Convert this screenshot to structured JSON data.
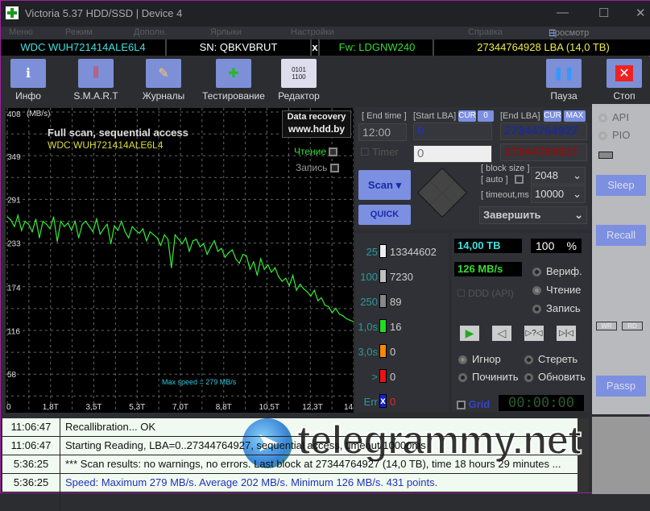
{
  "window": {
    "title": "Victoria 5.37 HDD/SSD | Device 4"
  },
  "menu": {
    "items": [
      "Меню",
      "Режим",
      "Дополн.",
      "Ярлыки",
      "Настройки",
      "Справка"
    ],
    "buffer_view": "Просмотр буфера"
  },
  "drive": {
    "model": "WDC  WUH721414ALE6L4",
    "serial": "SN: QBKVBRUT",
    "close": "x",
    "firmware": "Fw: LDGNW240",
    "capacity": "27344764928 LBA (14,0 TB)"
  },
  "toolbar": {
    "info": "Инфо",
    "smart": "S.M.A.R.T",
    "logs": "Журналы",
    "testing": "Тестирование",
    "editor": "Редактор",
    "pause": "Пауза",
    "stop": "Стоп"
  },
  "chart_overlay": {
    "title": "Full scan, sequential access",
    "model": "WDC  WUH721414ALE6L4",
    "brand_line1": "Data recovery",
    "brand_line2": "www.hdd.by",
    "legend_read": "Чтение",
    "legend_write": "Запись",
    "max_speed": "Max speed = 279 MB/s"
  },
  "chart_data": {
    "type": "line",
    "ylabel": "(MB/s)",
    "ylim": [
      0,
      408
    ],
    "xlim": [
      0,
      14
    ],
    "yticks": [
      "408",
      "349",
      "291",
      "233",
      "174",
      "116",
      "58"
    ],
    "ytick_values": [
      408,
      349,
      291,
      233,
      174,
      116,
      58
    ],
    "xticks": [
      "0",
      "1,8T",
      "3,5T",
      "5,3T",
      "7,0T",
      "8,8T",
      "10,5T",
      "12,3T",
      "14"
    ],
    "xtick_values": [
      0,
      1.75,
      3.5,
      5.25,
      7,
      8.75,
      10.5,
      12.25,
      14
    ],
    "series": [
      {
        "name": "Чтение",
        "color": "#33ee33",
        "values": [
          268,
          264,
          255,
          270,
          250,
          262,
          258,
          248,
          265,
          240,
          262,
          258,
          252,
          268,
          235,
          262,
          255,
          260,
          250,
          262,
          240,
          258,
          262,
          255,
          248,
          265,
          245,
          252,
          258,
          232,
          256,
          250,
          262,
          248,
          240,
          255,
          250,
          246,
          252,
          236,
          248,
          244,
          240,
          230,
          244,
          238,
          200,
          244,
          238,
          232,
          240,
          222,
          236,
          238,
          228,
          232,
          218,
          228,
          236,
          222,
          226,
          214,
          220,
          224,
          212,
          206,
          218,
          216,
          198,
          208,
          190,
          212,
          198,
          204,
          194,
          200,
          188,
          182,
          186,
          176,
          190,
          170,
          178,
          172,
          168,
          162,
          170,
          156,
          160,
          150,
          148,
          140,
          146,
          138,
          136,
          132,
          130,
          128
        ]
      }
    ]
  },
  "lba": {
    "end_time_label": "[ End time ]",
    "start_label": "[Start LBA]",
    "end_label": "[End LBA]",
    "cur": "CUR",
    "zero": "0",
    "max": "MAX",
    "end_time": "12:00",
    "start_value": "0",
    "end_value": "27344764927",
    "timer_label": "Timer",
    "timer_value": "0",
    "end_value2": "27344764927"
  },
  "scan": {
    "scan": "Scan",
    "quick": "QUICK",
    "block_size_label": "[ block size ]",
    "auto_label": "[ auto ]",
    "timeout_label": "[ timeout,ms ]",
    "block_size": "2048",
    "timeout": "10000",
    "finish": "Завершить"
  },
  "stats": [
    {
      "label": "25",
      "count": "13344602",
      "color": "#eeeeee"
    },
    {
      "label": "100",
      "count": "7230",
      "color": "#c0c0c0"
    },
    {
      "label": "250",
      "count": "89",
      "color": "#888888"
    },
    {
      "label": "1,0s",
      "count": "16",
      "color": "#22dd22"
    },
    {
      "label": "3,0s",
      "count": "0",
      "color": "#ff8800"
    },
    {
      "label": ">",
      "count": "0",
      "color": "#ee1111"
    },
    {
      "label": "Err",
      "count": "0",
      "color": "#1020dd"
    }
  ],
  "progress": {
    "size": "14,00 TB",
    "percent": "100",
    "percent_sign": "%",
    "speed": "126 MB/s",
    "ddd": "DDD (API)",
    "verify": "Вериф.",
    "read": "Чтение",
    "write": "Запись",
    "ignore": "Игнор",
    "erase": "Стереть",
    "repair": "Починить",
    "refresh": "Обновить",
    "grid": "Grid",
    "timer": "00:00:00",
    "percent_value": 100
  },
  "side": {
    "api": "API",
    "pio": "PIO",
    "sleep": "Sleep",
    "recall": "Recall",
    "wr": "WR",
    "rd": "RD",
    "passp": "Passp"
  },
  "log": [
    {
      "time": "11:06:47",
      "msg": "Recallibration... OK"
    },
    {
      "time": "11:06:47",
      "msg": "Starting Reading, LBA=0..27344764927, sequential access, timeout 10000ms"
    },
    {
      "time": "5:36:25",
      "msg": "*** Scan results: no warnings, no errors. Last block at 27344764927 (14,0 TB), time 18 hours 29 minutes ..."
    },
    {
      "time": "5:36:25",
      "msg": "Speed: Maximum 279 MB/s. Average 202 MB/s. Minimum 126 MB/s. 431 points."
    }
  ],
  "watermark": "telegrammy.net"
}
